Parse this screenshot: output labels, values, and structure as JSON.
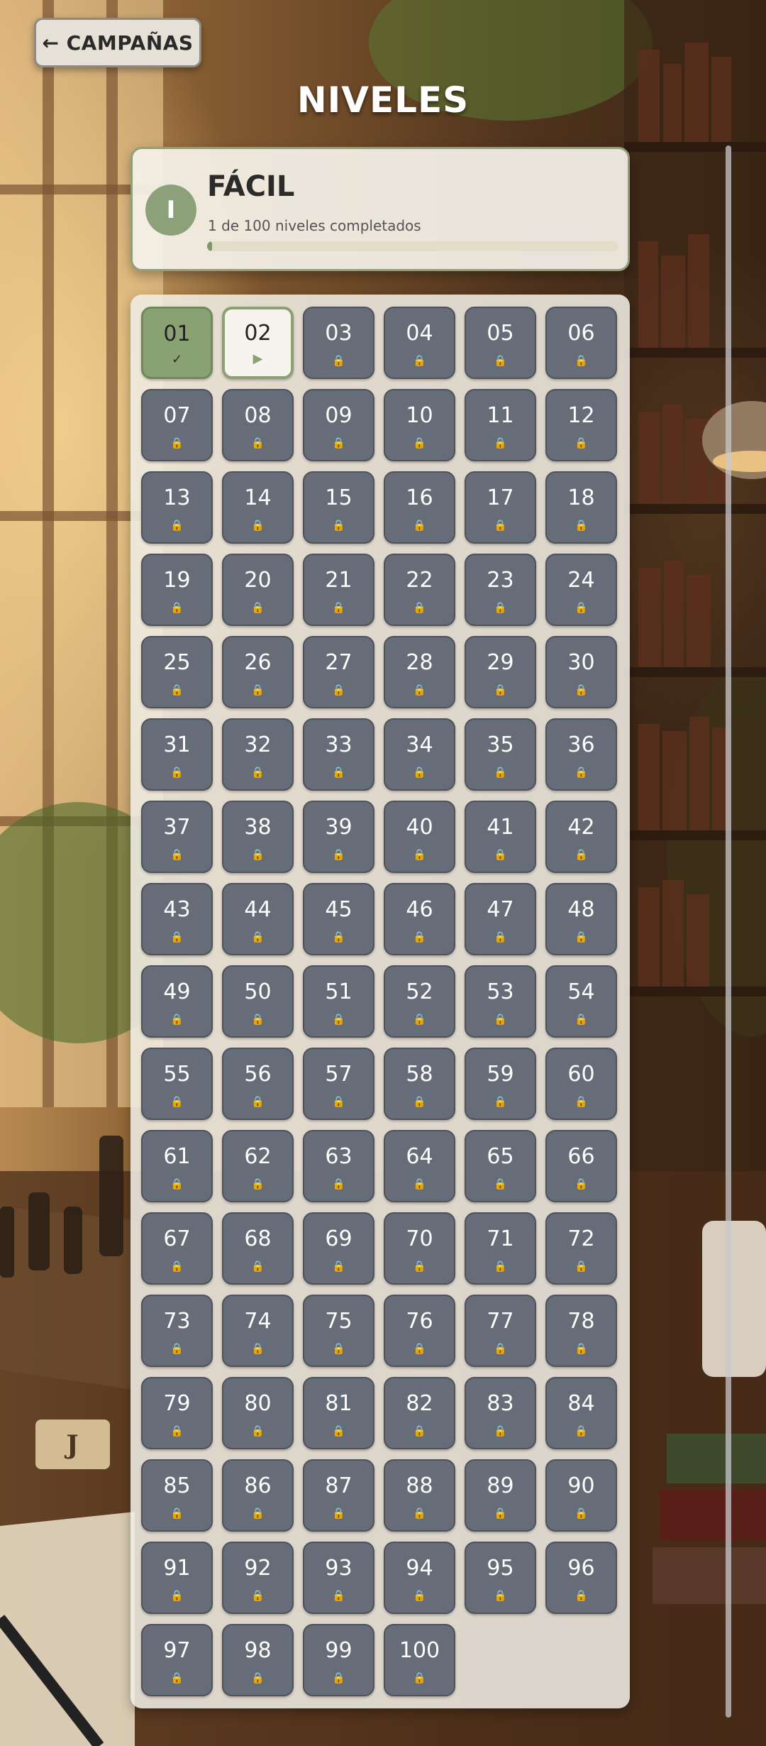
{
  "header": {
    "back_label": "← CAMPAÑAS",
    "title": "NIVELES"
  },
  "campaign": {
    "numeral": "I",
    "name": "FÁCIL",
    "progress_text": "1 de 100 niveles completados",
    "completed": 1,
    "total": 100,
    "progress_fraction": 0.01
  },
  "levels": {
    "total": 100,
    "completed": [
      "01"
    ],
    "current": "02",
    "completed_mark": "✓",
    "current_mark": "▶",
    "locked_mark": "🔒"
  },
  "colors": {
    "completed": "#8aa173",
    "current_border": "#8aa173",
    "locked": "#666c78",
    "lock_icon": "#f3b33a"
  }
}
